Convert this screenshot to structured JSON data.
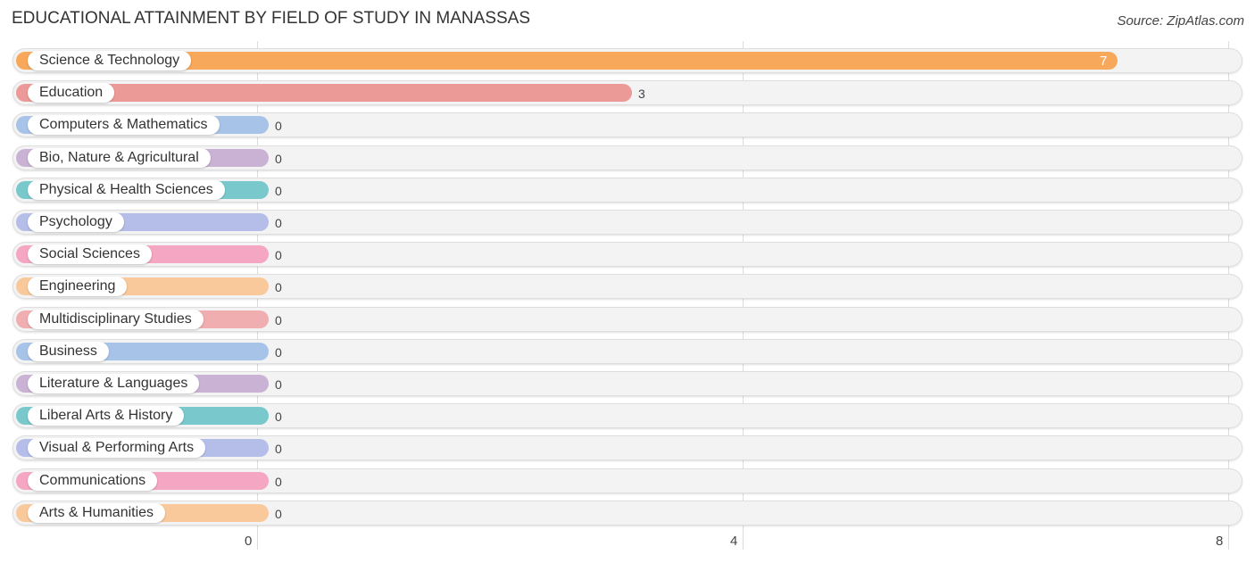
{
  "title": "EDUCATIONAL ATTAINMENT BY FIELD OF STUDY IN MANASSAS",
  "source": "Source: ZipAtlas.com",
  "chart_data": {
    "type": "bar",
    "orientation": "horizontal",
    "title": "EDUCATIONAL ATTAINMENT BY FIELD OF STUDY IN MANASSAS",
    "xlabel": "",
    "ylabel": "",
    "xlim": [
      0,
      8
    ],
    "xticks": [
      0,
      4,
      8
    ],
    "grid": true,
    "categories": [
      "Science & Technology",
      "Education",
      "Computers & Mathematics",
      "Bio, Nature & Agricultural",
      "Physical & Health Sciences",
      "Psychology",
      "Social Sciences",
      "Engineering",
      "Multidisciplinary Studies",
      "Business",
      "Literature & Languages",
      "Liberal Arts & History",
      "Visual & Performing Arts",
      "Communications",
      "Arts & Humanities"
    ],
    "values": [
      7,
      3,
      0,
      0,
      0,
      0,
      0,
      0,
      0,
      0,
      0,
      0,
      0,
      0,
      0
    ],
    "colors": [
      "#f7a85a",
      "#eb9a98",
      "#a7c4e8",
      "#c9b2d4",
      "#79c8cc",
      "#b5bde9",
      "#f4a6c2",
      "#f9c99c",
      "#f0aeb0",
      "#a7c4e8",
      "#c9b2d4",
      "#79c8cc",
      "#b5bde9",
      "#f4a6c2",
      "#f9c99c"
    ]
  }
}
